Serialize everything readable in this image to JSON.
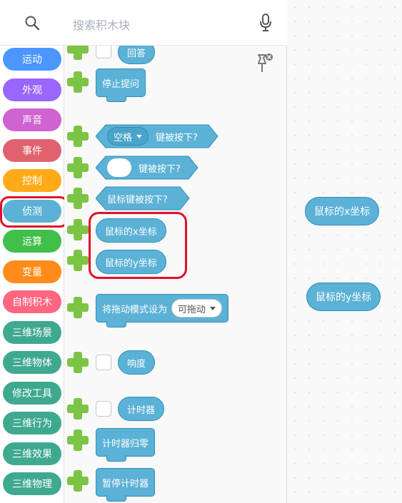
{
  "search": {
    "placeholder": "搜索积木块"
  },
  "categories": [
    {
      "label": "运动",
      "color": "#4c97ff"
    },
    {
      "label": "外观",
      "color": "#9966ff"
    },
    {
      "label": "声音",
      "color": "#cf63cf"
    },
    {
      "label": "事件",
      "color": "#e0626e"
    },
    {
      "label": "控制",
      "color": "#ffab19"
    },
    {
      "label": "侦测",
      "color": "#5cb1d6"
    },
    {
      "label": "运算",
      "color": "#40bf4a"
    },
    {
      "label": "变量",
      "color": "#ff8c1a"
    },
    {
      "label": "自制积木",
      "color": "#ff6680"
    },
    {
      "label": "三维场景",
      "color": "#3fa98f"
    },
    {
      "label": "三维物体",
      "color": "#3fa98f"
    },
    {
      "label": "修改工具",
      "color": "#3fa98f"
    },
    {
      "label": "三维行为",
      "color": "#3fa98f"
    },
    {
      "label": "三维效果",
      "color": "#3fa98f"
    },
    {
      "label": "三维物理",
      "color": "#3fa98f"
    }
  ],
  "blocks": {
    "answer": "回答",
    "stop_ask": "停止提问",
    "space": "空格",
    "key_pressed": "键被按下?",
    "key_pressed2": "键被按下?",
    "mouse_down": "鼠标键被按下?",
    "mouse_x": "鼠标的x坐标",
    "mouse_y": "鼠标的y坐标",
    "set_drag": "将拖动模式设为",
    "draggable": "可拖动",
    "loudness": "响度",
    "timer": "计时器",
    "reset_timer": "计时器归零",
    "pause_timer": "暂停计时器"
  },
  "stage": {
    "mouse_x": "鼠标的x坐标",
    "mouse_y": "鼠标的y坐标"
  },
  "colors": {
    "sensing": "#5cb1d6",
    "sensing_border": "#2e8eb8",
    "plus": "#7cc443",
    "highlight": "#e0102a"
  }
}
